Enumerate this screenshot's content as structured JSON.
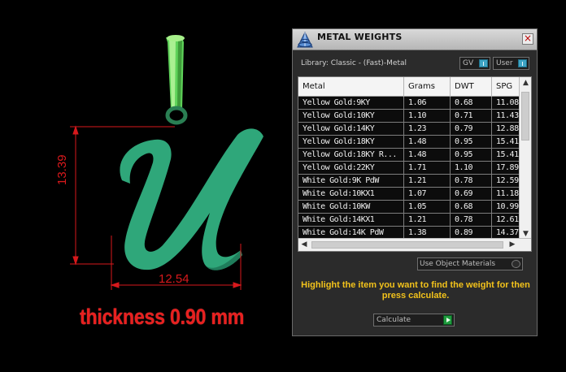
{
  "viewport": {
    "dimension_height": "13.39",
    "dimension_width": "12.54",
    "thickness_note": "thickness 0.90 mm",
    "colors": {
      "pendant": "#2fa77a",
      "bail": "#7ee06a",
      "dimension": "#d8191c"
    }
  },
  "dialog": {
    "title": "METAL WEIGHTS",
    "close_icon": "close-x",
    "library_label": "Library: Classic - (Fast)-Metal",
    "gv_toggle_label": "GV",
    "user_toggle_label": "User",
    "table": {
      "columns": [
        "Metal",
        "Grams",
        "DWT",
        "SPG"
      ],
      "rows": [
        [
          "Yellow Gold:9KY",
          "1.06",
          "0.68",
          "11.08"
        ],
        [
          "Yellow Gold:10KY",
          "1.10",
          "0.71",
          "11.43"
        ],
        [
          "Yellow Gold:14KY",
          "1.23",
          "0.79",
          "12.88"
        ],
        [
          "Yellow Gold:18KY",
          "1.48",
          "0.95",
          "15.41"
        ],
        [
          "Yellow Gold:18KY R...",
          "1.48",
          "0.95",
          "15.41"
        ],
        [
          "Yellow Gold:22KY",
          "1.71",
          "1.10",
          "17.89"
        ],
        [
          "White Gold:9K PdW",
          "1.21",
          "0.78",
          "12.59"
        ],
        [
          "White Gold:10KX1",
          "1.07",
          "0.69",
          "11.18"
        ],
        [
          "White Gold:10KW",
          "1.05",
          "0.68",
          "10.99"
        ],
        [
          "White Gold:14KX1",
          "1.21",
          "0.78",
          "12.61"
        ],
        [
          "White Gold:14K PdW",
          "1.38",
          "0.89",
          "14.37"
        ]
      ]
    },
    "use_object_materials_label": "Use Object Materials",
    "hint": "Highlight the item you want to find the weight for then press calculate.",
    "calculate_label": "Calculate",
    "colors": {
      "hint": "#f2c21b",
      "toggle_knob": "#3ea4c4",
      "calculate_go": "#1f9b3e"
    }
  }
}
